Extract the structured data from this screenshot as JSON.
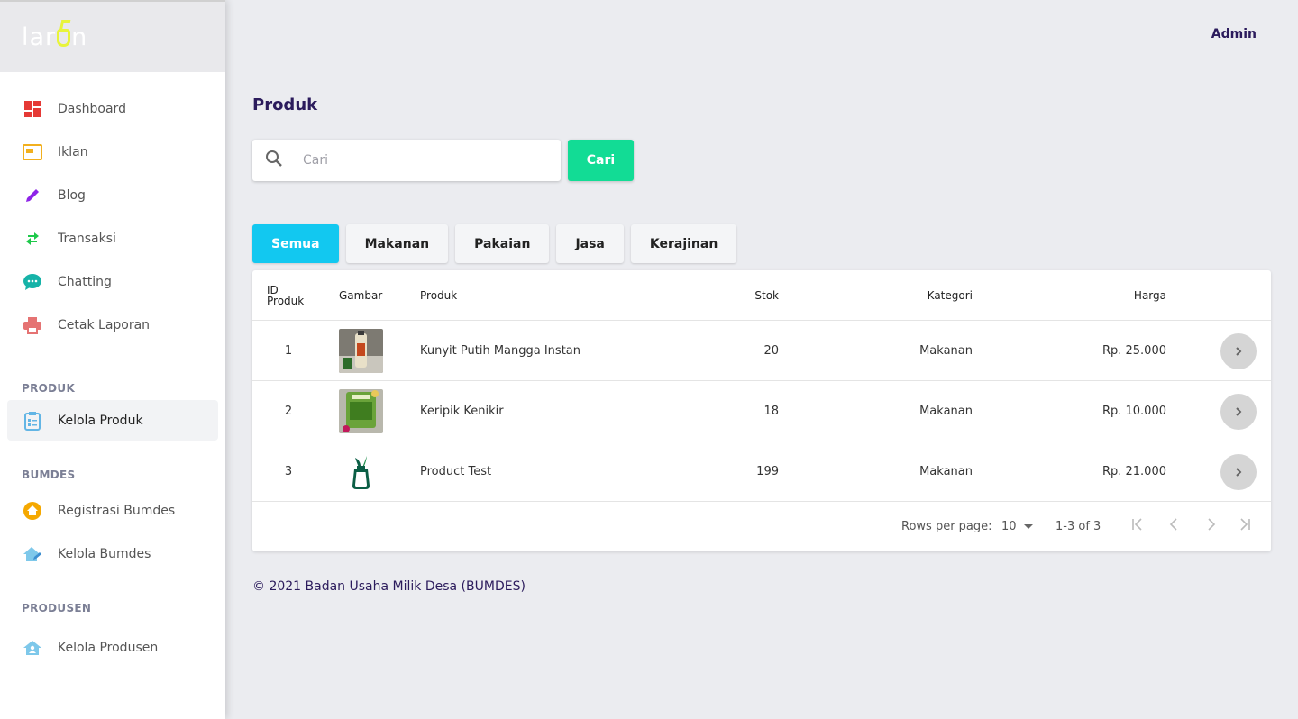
{
  "sidebar": {
    "logo": "laron",
    "items": [
      {
        "label": "Dashboard",
        "icon": "dashboard-icon"
      },
      {
        "label": "Iklan",
        "icon": "ad-icon"
      },
      {
        "label": "Blog",
        "icon": "pen-icon"
      },
      {
        "label": "Transaksi",
        "icon": "swap-icon"
      },
      {
        "label": "Chatting",
        "icon": "chat-icon"
      },
      {
        "label": "Cetak Laporan",
        "icon": "printer-icon"
      }
    ],
    "sections": {
      "produk": {
        "title": "PRODUK",
        "items": [
          {
            "label": "Kelola Produk",
            "icon": "clipboard-icon"
          }
        ]
      },
      "bumdes": {
        "title": "BUMDES",
        "items": [
          {
            "label": "Registrasi Bumdes",
            "icon": "home-icon"
          },
          {
            "label": "Kelola Bumdes",
            "icon": "house-edit-icon"
          }
        ]
      },
      "produsen": {
        "title": "PRODUSEN",
        "items": [
          {
            "label": "Kelola Produsen",
            "icon": "house-user-icon"
          }
        ]
      }
    }
  },
  "header": {
    "user": "Admin"
  },
  "page": {
    "title": "Produk"
  },
  "search": {
    "placeholder": "Cari",
    "button": "Cari"
  },
  "tabs": [
    "Semua",
    "Makanan",
    "Pakaian",
    "Jasa",
    "Kerajinan"
  ],
  "table": {
    "columns": {
      "id": "ID Produk",
      "image": "Gambar",
      "product": "Produk",
      "stock": "Stok",
      "category": "Kategori",
      "price": "Harga"
    },
    "rows": [
      {
        "id": "1",
        "product": "Kunyit Putih Mangga Instan",
        "stock": "20",
        "category": "Makanan",
        "price": "Rp. 25.000"
      },
      {
        "id": "2",
        "product": "Keripik Kenikir",
        "stock": "18",
        "category": "Makanan",
        "price": "Rp. 10.000"
      },
      {
        "id": "3",
        "product": "Product Test",
        "stock": "199",
        "category": "Makanan",
        "price": "Rp. 21.000"
      }
    ],
    "pagination": {
      "rows_label": "Rows per page:",
      "rows_value": "10",
      "range": "1-3 of 3"
    }
  },
  "footer": {
    "copyright": "© 2021 Badan Usaha Milik Desa (BUMDES)"
  },
  "colors": {
    "accent_green": "#12dc95",
    "accent_cyan": "#12c8f0",
    "title_purple": "#2b1b5c"
  }
}
